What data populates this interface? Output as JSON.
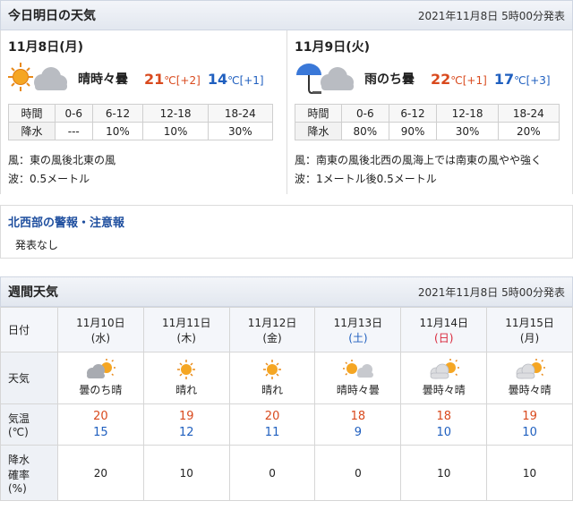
{
  "today_section": {
    "title": "今日明日の天気",
    "announced": "2021年11月8日 5時00分発表"
  },
  "days": [
    {
      "date": "11月8日(月)",
      "icon": "sun-cloud-icon",
      "weather": "晴時々曇",
      "high": "21",
      "high_diff": "[+2]",
      "low": "14",
      "low_diff": "[+1]",
      "unit": "℃",
      "time_label": "時間",
      "rain_label": "降水",
      "times": [
        "0-6",
        "6-12",
        "12-18",
        "18-24"
      ],
      "rain": [
        "---",
        "10%",
        "10%",
        "30%"
      ],
      "wind": "風：東の風後北東の風",
      "wave": "波：0.5メートル"
    },
    {
      "date": "11月9日(火)",
      "icon": "umbrella-cloud-icon",
      "weather": "雨のち曇",
      "high": "22",
      "high_diff": "[+1]",
      "low": "17",
      "low_diff": "[+3]",
      "unit": "℃",
      "time_label": "時間",
      "rain_label": "降水",
      "times": [
        "0-6",
        "6-12",
        "12-18",
        "18-24"
      ],
      "rain": [
        "80%",
        "90%",
        "30%",
        "20%"
      ],
      "wind": "風：南東の風後北西の風海上では南東の風やや強く",
      "wave": "波：1メートル後0.5メートル"
    }
  ],
  "warning": {
    "title": "北西部の警報・注意報",
    "body": "発表なし"
  },
  "weekly_section": {
    "title": "週間天気",
    "announced": "2021年11月8日 5時00分発表"
  },
  "weekly": {
    "labels": {
      "date": "日付",
      "weather": "天気",
      "temp_1": "気温",
      "temp_2": "(℃)",
      "pop_1": "降水",
      "pop_2": "確率",
      "pop_3": "(%)"
    },
    "days": [
      {
        "date": "11月10日",
        "dow": "(水)",
        "icon": "cloud-sun-icon",
        "weather": "曇のち晴",
        "high": "20",
        "low": "15",
        "pop": "20"
      },
      {
        "date": "11月11日",
        "dow": "(木)",
        "icon": "sun-icon",
        "weather": "晴れ",
        "high": "19",
        "low": "12",
        "pop": "10"
      },
      {
        "date": "11月12日",
        "dow": "(金)",
        "icon": "sun-icon",
        "weather": "晴れ",
        "high": "20",
        "low": "11",
        "pop": "0"
      },
      {
        "date": "11月13日",
        "dow": "(土)",
        "icon": "sun-cloud-icon",
        "weather": "晴時々曇",
        "high": "18",
        "low": "9",
        "pop": "0"
      },
      {
        "date": "11月14日",
        "dow": "(日)",
        "icon": "cloud-sun-icon",
        "weather": "曇時々晴",
        "high": "18",
        "low": "10",
        "pop": "10"
      },
      {
        "date": "11月15日",
        "dow": "(月)",
        "icon": "cloud-sun-icon",
        "weather": "曇時々晴",
        "high": "19",
        "low": "10",
        "pop": "10"
      }
    ]
  },
  "colors": {
    "high": "#d94a1e",
    "low": "#1f5fbf",
    "saturday": "#1f5fbf",
    "sunday": "#d9263a",
    "link": "#1f4f9f"
  }
}
